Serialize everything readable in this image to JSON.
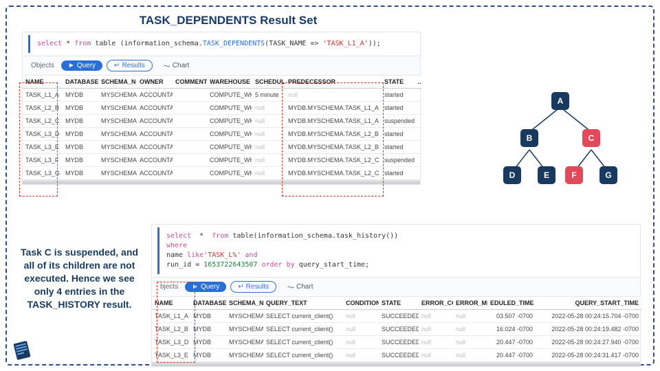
{
  "titles": {
    "dependents": "TASK_DEPENDENTS Result Set",
    "history": "TASK_HISTORY Result Set"
  },
  "explain": "Task C is suspended, and all of its children are not executed. Hence we see only 4 entries in the TASK_HISTORY result.",
  "sql1": {
    "select": "select",
    "star": " * ",
    "from": "from",
    "table": " table ",
    "open": "(information_schema.",
    "fn": "TASK_DEPENDENTS",
    "args_open": "(TASK_NAME => ",
    "arg": "'TASK_L1_A'",
    "close": "));"
  },
  "sql2": {
    "l1a": "select",
    "l1b": "  *  ",
    "l1c": "from",
    "l1d": " table",
    "l1e": "(information_schema.task_history())",
    "l2a": "where",
    "l3a": "name ",
    "l3b": "like",
    "l3c": "'TASK_L%'",
    "l3d": " and",
    "l4a": "run_id = ",
    "l4b": "1653722643507",
    "l4c": " order by",
    "l4d": " query_start_time;"
  },
  "toolbar": {
    "objects": "Objects",
    "objects2": "bjects",
    "query": "Query",
    "results": "Results",
    "chart": "Chart",
    "play": "►",
    "back": "↵",
    "chartIcon": "〜"
  },
  "dep": {
    "cols": [
      "NAME",
      "DATABASE_",
      "SCHEMA_N",
      "OWNER",
      "COMMENT",
      "WAREHOUSE",
      "SCHEDULE",
      "PREDECESSOR",
      "STATE",
      "…"
    ],
    "rows": [
      {
        "name": "TASK_L1_A",
        "db": "MYDB",
        "schema": "MYSCHEMA",
        "owner": "ACCOUNTA",
        "comment": "",
        "wh": "COMPUTE_WH",
        "sched": "5 minute",
        "pred": "null",
        "state": "started"
      },
      {
        "name": "TASK_L2_B",
        "db": "MYDB",
        "schema": "MYSCHEMA",
        "owner": "ACCOUNTA",
        "comment": "",
        "wh": "COMPUTE_WH",
        "sched": "null",
        "pred": "MYDB.MYSCHEMA.TASK_L1_A",
        "state": "started"
      },
      {
        "name": "TASK_L2_C",
        "db": "MYDB",
        "schema": "MYSCHEMA",
        "owner": "ACCOUNTA",
        "comment": "",
        "wh": "COMPUTE_WH",
        "sched": "null",
        "pred": "MYDB.MYSCHEMA.TASK_L1_A",
        "state": "suspended"
      },
      {
        "name": "TASK_L3_D",
        "db": "MYDB",
        "schema": "MYSCHEMA",
        "owner": "ACCOUNTA",
        "comment": "",
        "wh": "COMPUTE_WH",
        "sched": "null",
        "pred": "MYDB.MYSCHEMA.TASK_L2_B",
        "state": "started"
      },
      {
        "name": "TASK_L3_E",
        "db": "MYDB",
        "schema": "MYSCHEMA",
        "owner": "ACCOUNTA",
        "comment": "",
        "wh": "COMPUTE_WH",
        "sched": "null",
        "pred": "MYDB.MYSCHEMA.TASK_L2_B",
        "state": "started"
      },
      {
        "name": "TASK_L3_F",
        "db": "MYDB",
        "schema": "MYSCHEMA",
        "owner": "ACCOUNTA",
        "comment": "",
        "wh": "COMPUTE_WH",
        "sched": "null",
        "pred": "MYDB.MYSCHEMA.TASK_L2_C",
        "state": "suspended"
      },
      {
        "name": "TASK_L3_G",
        "db": "MYDB",
        "schema": "MYSCHEMA",
        "owner": "ACCOUNTA",
        "comment": "",
        "wh": "COMPUTE_WH",
        "sched": "null",
        "pred": "MYDB.MYSCHEMA.TASK_L2_C",
        "state": "started"
      }
    ]
  },
  "hist": {
    "cols": [
      "NAME",
      "DATABASE_",
      "SCHEMA_N",
      "QUERY_TEXT",
      "CONDITION",
      "STATE",
      "ERROR_CO",
      "ERROR_ME",
      "EDULED_TIME",
      "QUERY_START_TIME"
    ],
    "rows": [
      {
        "name": "TASK_L1_A",
        "db": "MYDB",
        "schema": "MYSCHEMA",
        "q": "SELECT current_client()",
        "cond": "null",
        "state": "SUCCEEDED",
        "ec": "null",
        "em": "null",
        "st": "03.507 -0700",
        "qst": "2022-05-28 00:24:15.704 -0700"
      },
      {
        "name": "TASK_L2_B",
        "db": "MYDB",
        "schema": "MYSCHEMA",
        "q": "SELECT current_client()",
        "cond": "null",
        "state": "SUCCEEDED",
        "ec": "null",
        "em": "null",
        "st": "16.024 -0700",
        "qst": "2022-05-28 00:24:19.482 -0700"
      },
      {
        "name": "TASK_L3_D",
        "db": "MYDB",
        "schema": "MYSCHEMA",
        "q": "SELECT current_client()",
        "cond": "null",
        "state": "SUCCEEDED",
        "ec": "null",
        "em": "null",
        "st": "20.447 -0700",
        "qst": "2022-05-28 00:24:27.940 -0700"
      },
      {
        "name": "TASK_L3_E",
        "db": "MYDB",
        "schema": "MYSCHEMA",
        "q": "SELECT current_client()",
        "cond": "null",
        "state": "SUCCEEDED",
        "ec": "null",
        "em": "null",
        "st": "20.447 -0700",
        "qst": "2022-05-28 00:24:31.417 -0700"
      }
    ]
  },
  "tree": {
    "A": "A",
    "B": "B",
    "C": "C",
    "D": "D",
    "E": "E",
    "F": "F",
    "G": "G"
  }
}
